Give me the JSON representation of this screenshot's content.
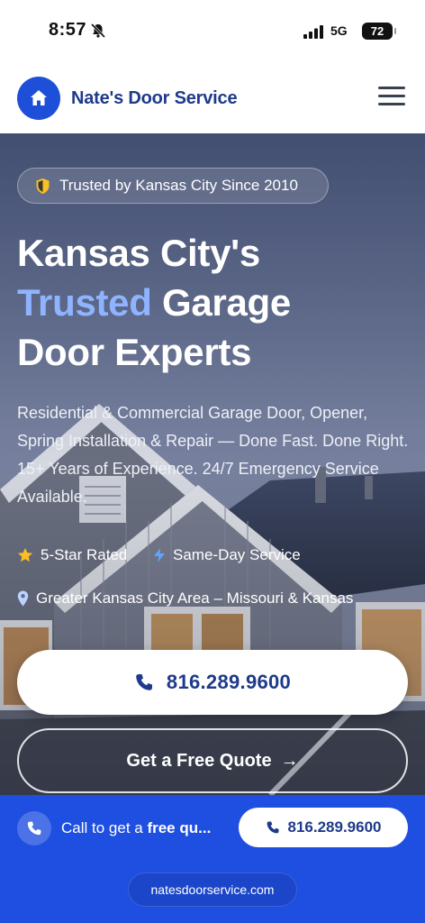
{
  "status_bar": {
    "time": "8:57",
    "network": "5G",
    "battery": "72"
  },
  "header": {
    "brand": "Nate's Door Service",
    "icons": {
      "logo": "home-icon",
      "menu": "hamburger-menu-icon"
    }
  },
  "hero": {
    "badge": "Trusted by Kansas City Since 2010",
    "headline": {
      "line1": "Kansas City's",
      "accent": "Trusted",
      "line2_rest": " Garage",
      "line3": "Door Experts"
    },
    "subcopy": "Residential & Commercial Garage Door, Opener, Spring Installation & Repair — Done Fast. Done Right. 15+ Years of Experience. 24/7 Emergency Service Available.",
    "features": [
      {
        "label": "5-Star Rated",
        "icon": "star-icon"
      },
      {
        "label": "Same-Day Service",
        "icon": "lightning-icon"
      },
      {
        "label": "Greater Kansas City Area – Missouri & Kansas",
        "icon": "location-pin-icon"
      }
    ],
    "call_button": "816.289.9600",
    "quote_button": "Get a Free Quote",
    "quote_arrow": "→"
  },
  "sticky_bar": {
    "text_prefix": "Call to get a ",
    "text_bold": "free qu...",
    "call_button": "816.289.9600",
    "url": "natesdoorservice.com"
  },
  "colors": {
    "brand_blue": "#1e4fd8",
    "navy_text": "#1e3a8a",
    "accent_light_blue": "#8fb4ff",
    "star": "#fbbf24",
    "bolt": "#60a5fa"
  }
}
